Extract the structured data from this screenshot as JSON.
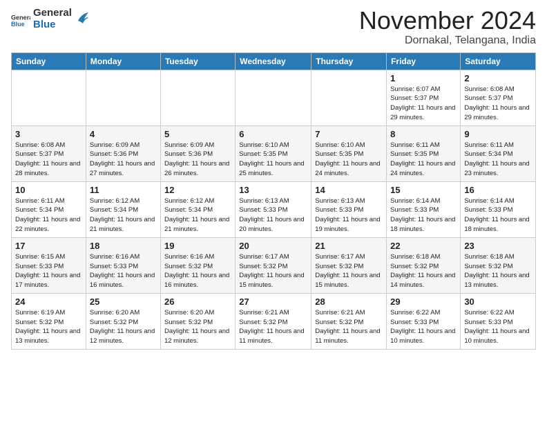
{
  "header": {
    "logo_general": "General",
    "logo_blue": "Blue",
    "month_title": "November 2024",
    "location": "Dornakal, Telangana, India"
  },
  "weekdays": [
    "Sunday",
    "Monday",
    "Tuesday",
    "Wednesday",
    "Thursday",
    "Friday",
    "Saturday"
  ],
  "weeks": [
    [
      {
        "day": "",
        "info": ""
      },
      {
        "day": "",
        "info": ""
      },
      {
        "day": "",
        "info": ""
      },
      {
        "day": "",
        "info": ""
      },
      {
        "day": "",
        "info": ""
      },
      {
        "day": "1",
        "info": "Sunrise: 6:07 AM\nSunset: 5:37 PM\nDaylight: 11 hours and 29 minutes."
      },
      {
        "day": "2",
        "info": "Sunrise: 6:08 AM\nSunset: 5:37 PM\nDaylight: 11 hours and 29 minutes."
      }
    ],
    [
      {
        "day": "3",
        "info": "Sunrise: 6:08 AM\nSunset: 5:37 PM\nDaylight: 11 hours and 28 minutes."
      },
      {
        "day": "4",
        "info": "Sunrise: 6:09 AM\nSunset: 5:36 PM\nDaylight: 11 hours and 27 minutes."
      },
      {
        "day": "5",
        "info": "Sunrise: 6:09 AM\nSunset: 5:36 PM\nDaylight: 11 hours and 26 minutes."
      },
      {
        "day": "6",
        "info": "Sunrise: 6:10 AM\nSunset: 5:35 PM\nDaylight: 11 hours and 25 minutes."
      },
      {
        "day": "7",
        "info": "Sunrise: 6:10 AM\nSunset: 5:35 PM\nDaylight: 11 hours and 24 minutes."
      },
      {
        "day": "8",
        "info": "Sunrise: 6:11 AM\nSunset: 5:35 PM\nDaylight: 11 hours and 24 minutes."
      },
      {
        "day": "9",
        "info": "Sunrise: 6:11 AM\nSunset: 5:34 PM\nDaylight: 11 hours and 23 minutes."
      }
    ],
    [
      {
        "day": "10",
        "info": "Sunrise: 6:11 AM\nSunset: 5:34 PM\nDaylight: 11 hours and 22 minutes."
      },
      {
        "day": "11",
        "info": "Sunrise: 6:12 AM\nSunset: 5:34 PM\nDaylight: 11 hours and 21 minutes."
      },
      {
        "day": "12",
        "info": "Sunrise: 6:12 AM\nSunset: 5:34 PM\nDaylight: 11 hours and 21 minutes."
      },
      {
        "day": "13",
        "info": "Sunrise: 6:13 AM\nSunset: 5:33 PM\nDaylight: 11 hours and 20 minutes."
      },
      {
        "day": "14",
        "info": "Sunrise: 6:13 AM\nSunset: 5:33 PM\nDaylight: 11 hours and 19 minutes."
      },
      {
        "day": "15",
        "info": "Sunrise: 6:14 AM\nSunset: 5:33 PM\nDaylight: 11 hours and 18 minutes."
      },
      {
        "day": "16",
        "info": "Sunrise: 6:14 AM\nSunset: 5:33 PM\nDaylight: 11 hours and 18 minutes."
      }
    ],
    [
      {
        "day": "17",
        "info": "Sunrise: 6:15 AM\nSunset: 5:33 PM\nDaylight: 11 hours and 17 minutes."
      },
      {
        "day": "18",
        "info": "Sunrise: 6:16 AM\nSunset: 5:33 PM\nDaylight: 11 hours and 16 minutes."
      },
      {
        "day": "19",
        "info": "Sunrise: 6:16 AM\nSunset: 5:32 PM\nDaylight: 11 hours and 16 minutes."
      },
      {
        "day": "20",
        "info": "Sunrise: 6:17 AM\nSunset: 5:32 PM\nDaylight: 11 hours and 15 minutes."
      },
      {
        "day": "21",
        "info": "Sunrise: 6:17 AM\nSunset: 5:32 PM\nDaylight: 11 hours and 15 minutes."
      },
      {
        "day": "22",
        "info": "Sunrise: 6:18 AM\nSunset: 5:32 PM\nDaylight: 11 hours and 14 minutes."
      },
      {
        "day": "23",
        "info": "Sunrise: 6:18 AM\nSunset: 5:32 PM\nDaylight: 11 hours and 13 minutes."
      }
    ],
    [
      {
        "day": "24",
        "info": "Sunrise: 6:19 AM\nSunset: 5:32 PM\nDaylight: 11 hours and 13 minutes."
      },
      {
        "day": "25",
        "info": "Sunrise: 6:20 AM\nSunset: 5:32 PM\nDaylight: 11 hours and 12 minutes."
      },
      {
        "day": "26",
        "info": "Sunrise: 6:20 AM\nSunset: 5:32 PM\nDaylight: 11 hours and 12 minutes."
      },
      {
        "day": "27",
        "info": "Sunrise: 6:21 AM\nSunset: 5:32 PM\nDaylight: 11 hours and 11 minutes."
      },
      {
        "day": "28",
        "info": "Sunrise: 6:21 AM\nSunset: 5:32 PM\nDaylight: 11 hours and 11 minutes."
      },
      {
        "day": "29",
        "info": "Sunrise: 6:22 AM\nSunset: 5:33 PM\nDaylight: 11 hours and 10 minutes."
      },
      {
        "day": "30",
        "info": "Sunrise: 6:22 AM\nSunset: 5:33 PM\nDaylight: 11 hours and 10 minutes."
      }
    ]
  ]
}
